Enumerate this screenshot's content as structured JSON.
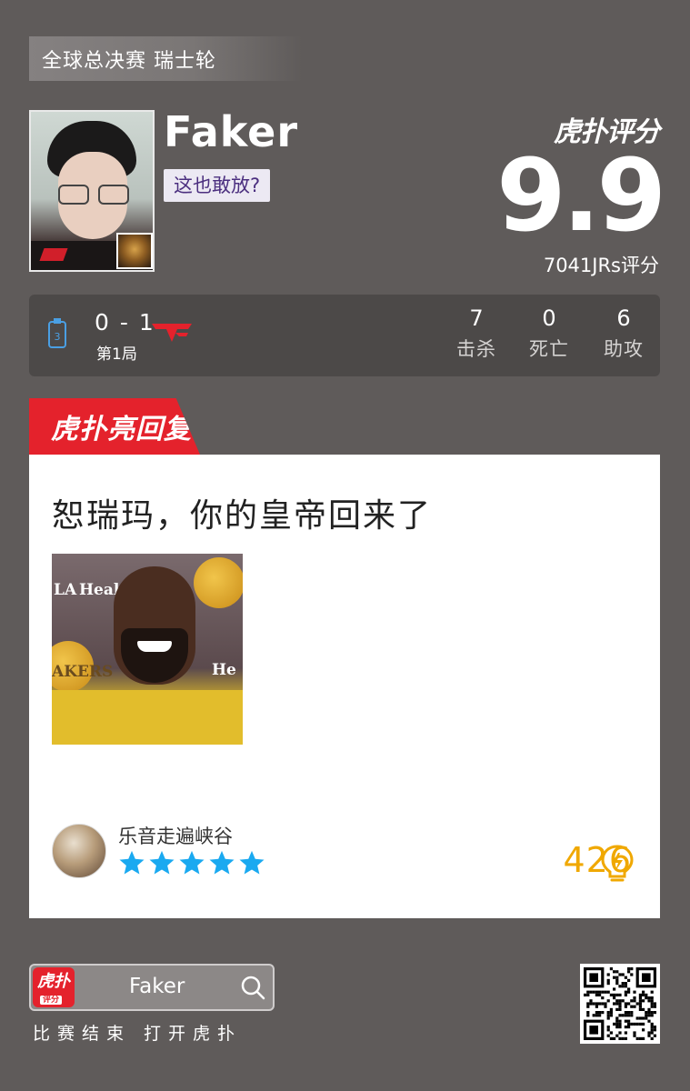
{
  "event": {
    "title": "全球总决赛 瑞士轮"
  },
  "player": {
    "name": "Faker",
    "tag": "这也敢放?"
  },
  "rating": {
    "brand": "虎扑评分",
    "score": "9.9",
    "count": "7041JRs评分"
  },
  "match": {
    "score": "0 - 1",
    "game": "第1局",
    "stats": [
      {
        "value": "7",
        "label": "击杀"
      },
      {
        "value": "0",
        "label": "死亡"
      },
      {
        "value": "6",
        "label": "助攻"
      }
    ]
  },
  "highlight": {
    "tab_label": "虎扑亮回复",
    "comment": "恕瑞玛，你的皇帝回来了",
    "image_signs": [
      "Healt",
      "AKERS",
      "He",
      "LA"
    ],
    "user": {
      "name": "乐音走遍峡谷",
      "stars": 5
    },
    "likes": "426"
  },
  "footer": {
    "app_icon_text": "虎扑",
    "app_icon_sub": "评分",
    "search_text": "Faker",
    "cta": "比赛结束 打开虎扑"
  },
  "colors": {
    "accent": "#e4222c",
    "background": "#5f5b5a",
    "star": "#1aa9f0",
    "likes": "#f0a800"
  },
  "icons": [
    "search-icon",
    "star-icon",
    "lightbulb-icon",
    "qr-code",
    "team-logo"
  ]
}
